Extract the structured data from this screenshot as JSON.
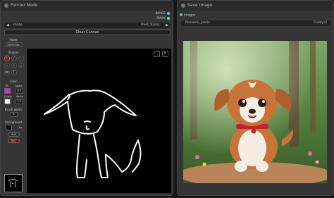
{
  "painter_node": {
    "title": "Painter Node",
    "outputs": [
      {
        "label": "IMAGE",
        "color": "#6bc1e6"
      },
      {
        "label": "MASK",
        "color": "#7ee07e"
      }
    ],
    "image_widget": {
      "label": "image",
      "value": "Paint_8.png"
    },
    "clear_button": "Clear Canvas",
    "tools": {
      "mode_label": "Mode:",
      "mode_button": "Selection",
      "shapes_label": "Shapes:",
      "shapes": [
        {
          "icon": "pencil-icon",
          "glyph": "✎"
        },
        {
          "icon": "line-icon",
          "glyph": "╱"
        },
        {
          "icon": "curve-icon",
          "glyph": "∿"
        },
        {
          "icon": "rect-icon",
          "glyph": "▭"
        },
        {
          "icon": "circle-icon",
          "glyph": "○"
        },
        {
          "icon": "triangle-icon",
          "glyph": "△"
        },
        {
          "icon": "erase-icon",
          "glyph": "⌫"
        },
        {
          "icon": "text-icon",
          "glyph": "T"
        }
      ],
      "color_label": "Color:",
      "fill_label": "Fill",
      "alpha_label": "Alpha",
      "fill_color": "#e020e0",
      "fill_alpha": "0.3",
      "stroke_label": "Stroke",
      "stroke_alpha_label": "Alpha",
      "stroke_color": "#ffffff",
      "stroke_alpha": "1.0",
      "brush_width_label": "Brush width:",
      "brush_width": "5",
      "background_label": "Background:",
      "background_value": "bg",
      "background_color": "#000000",
      "io_in": "IN/G",
      "io_out": "M/G"
    }
  },
  "save_node": {
    "title": "Save Image",
    "input_label": "images",
    "prefix_widget": {
      "label": "filename_prefix",
      "value": "ComfyUI"
    }
  }
}
